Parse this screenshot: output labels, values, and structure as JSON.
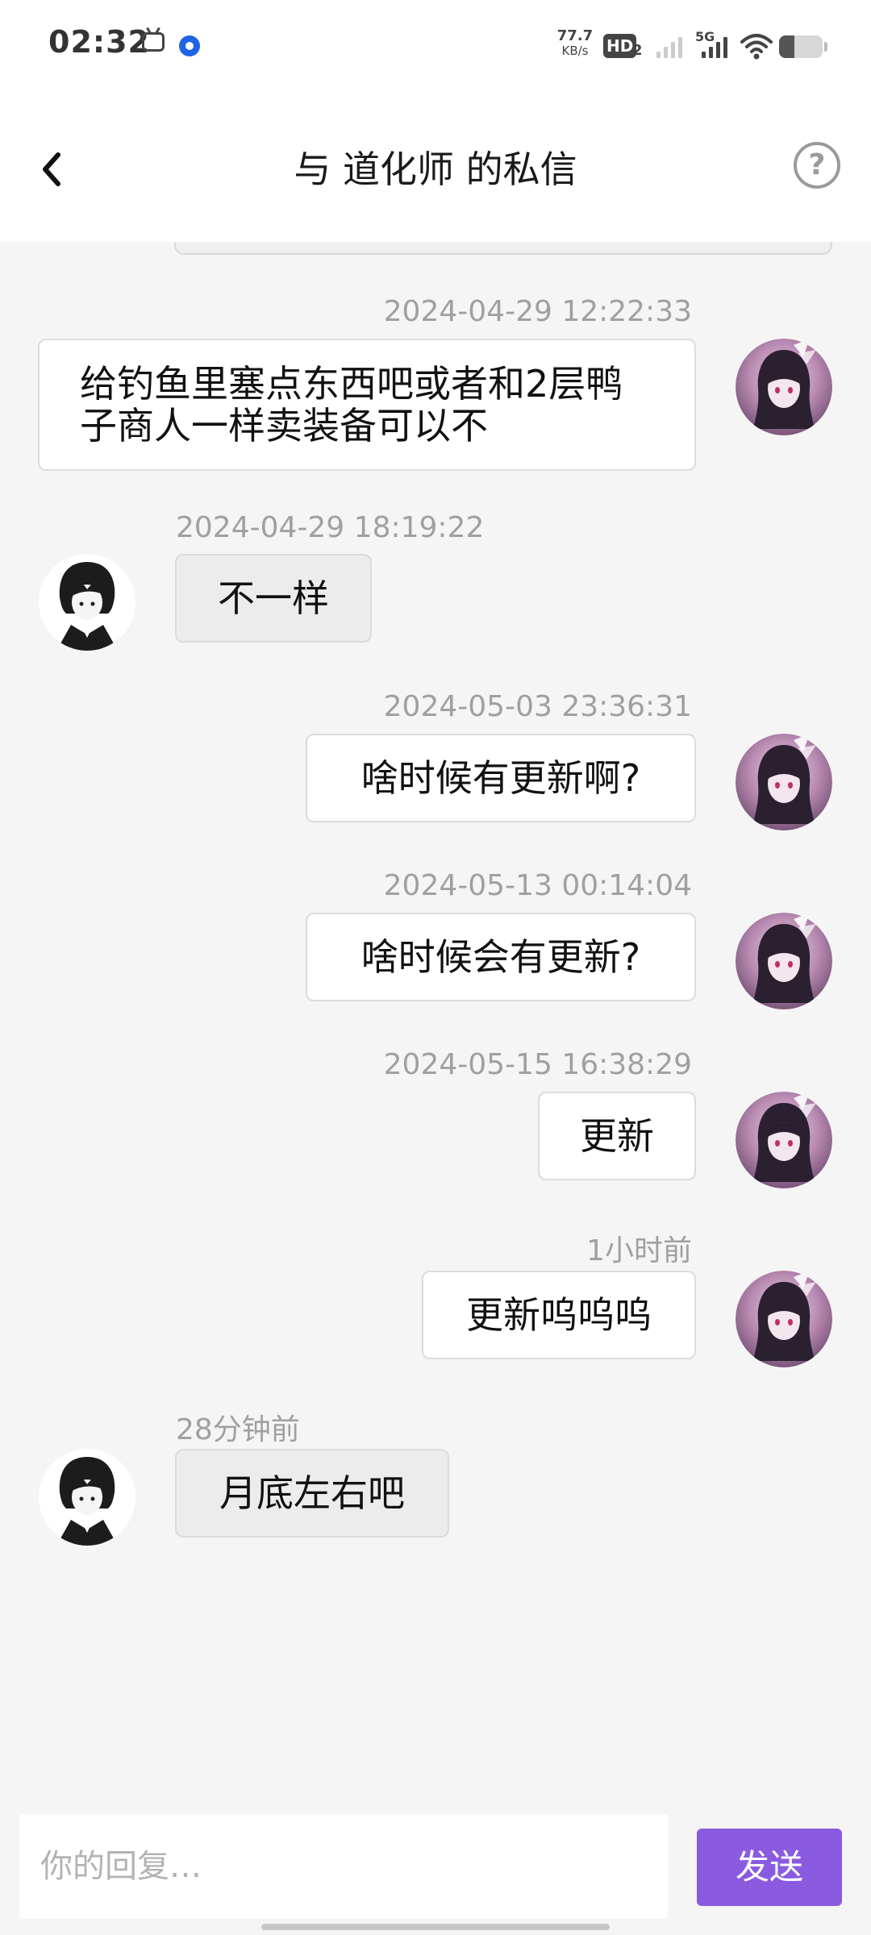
{
  "status_bar": {
    "time": "02:32",
    "app_icons": [
      "bilibili-tv-icon",
      "blue-circle-app-icon"
    ],
    "network_speed_value": "77.7",
    "network_speed_unit": "KB/s",
    "hd_label": "HD",
    "hd_sub": "2",
    "network_type": "5G",
    "battery_level": 0.35
  },
  "header": {
    "title": "与 道化师 的私信",
    "back_icon": "chevron-left-icon",
    "help_icon": "question-circle-icon",
    "help_glyph": "?"
  },
  "messages": [
    {
      "sender": "me",
      "timestamp": "2024-04-29 12:22:33",
      "lines": [
        "给钓鱼里塞点东西吧或者和2层鸭",
        "子商人一样卖装备可以不"
      ]
    },
    {
      "sender": "them",
      "timestamp": "2024-04-29 18:19:22",
      "text": "不一样"
    },
    {
      "sender": "me",
      "timestamp": "2024-05-03 23:36:31",
      "text": "啥时候有更新啊?"
    },
    {
      "sender": "me",
      "timestamp": "2024-05-13 00:14:04",
      "text": "啥时候会有更新?"
    },
    {
      "sender": "me",
      "timestamp": "2024-05-15 16:38:29",
      "text": "更新"
    },
    {
      "sender": "me",
      "timestamp": "1小时前",
      "text": "更新呜呜呜"
    },
    {
      "sender": "them",
      "timestamp": "28分钟前",
      "text": "月底左右吧"
    }
  ],
  "composer": {
    "placeholder": "你的回复…",
    "value": "",
    "send_label": "发送"
  },
  "colors": {
    "accent": "#8a5be0",
    "background": "#f5f5f5",
    "timestamp": "#a0a0a0",
    "their_bubble": "#ececec",
    "my_bubble": "#ffffff"
  }
}
